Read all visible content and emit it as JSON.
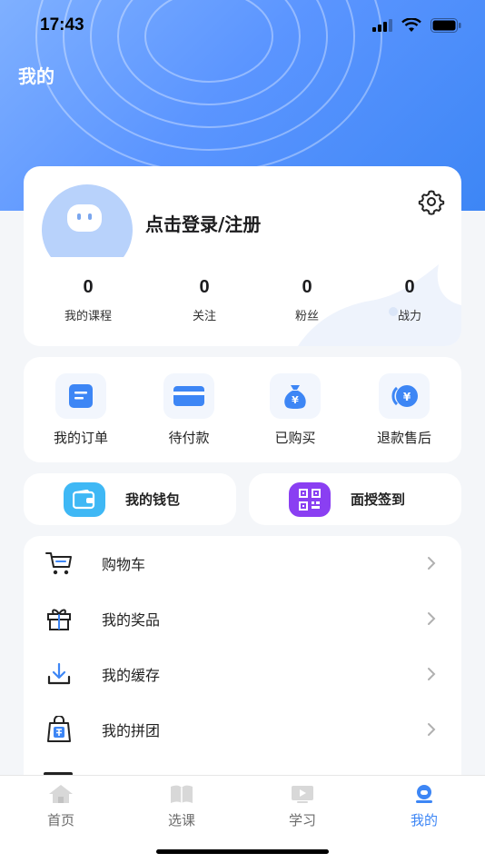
{
  "status_bar": {
    "time": "17:43"
  },
  "page": {
    "title": "我的"
  },
  "profile": {
    "login_text": "点击登录/注册",
    "stats": [
      {
        "value": "0",
        "label": "我的课程"
      },
      {
        "value": "0",
        "label": "关注"
      },
      {
        "value": "0",
        "label": "粉丝"
      },
      {
        "value": "0",
        "label": "战力"
      }
    ]
  },
  "orders": [
    {
      "label": "我的订单",
      "icon": "order-list-icon"
    },
    {
      "label": "待付款",
      "icon": "card-icon"
    },
    {
      "label": "已购买",
      "icon": "money-bag-icon"
    },
    {
      "label": "退款售后",
      "icon": "refund-icon"
    }
  ],
  "quick": {
    "wallet": {
      "label": "我的钱包",
      "icon": "wallet-icon",
      "color": "#3fb8f5"
    },
    "checkin": {
      "label": "面授签到",
      "icon": "qr-code-icon",
      "color": "#8a3ff2"
    }
  },
  "menu": [
    {
      "label": "购物车",
      "icon": "cart-icon"
    },
    {
      "label": "我的奖品",
      "icon": "gift-icon"
    },
    {
      "label": "我的缓存",
      "icon": "download-icon"
    },
    {
      "label": "我的拼团",
      "icon": "group-buy-icon"
    }
  ],
  "tabs": [
    {
      "label": "首页",
      "icon": "home-icon"
    },
    {
      "label": "选课",
      "icon": "book-icon"
    },
    {
      "label": "学习",
      "icon": "video-icon"
    },
    {
      "label": "我的",
      "icon": "profile-icon",
      "active": true
    }
  ],
  "colors": {
    "accent": "#3d86f5",
    "header": "#5b95ff"
  }
}
